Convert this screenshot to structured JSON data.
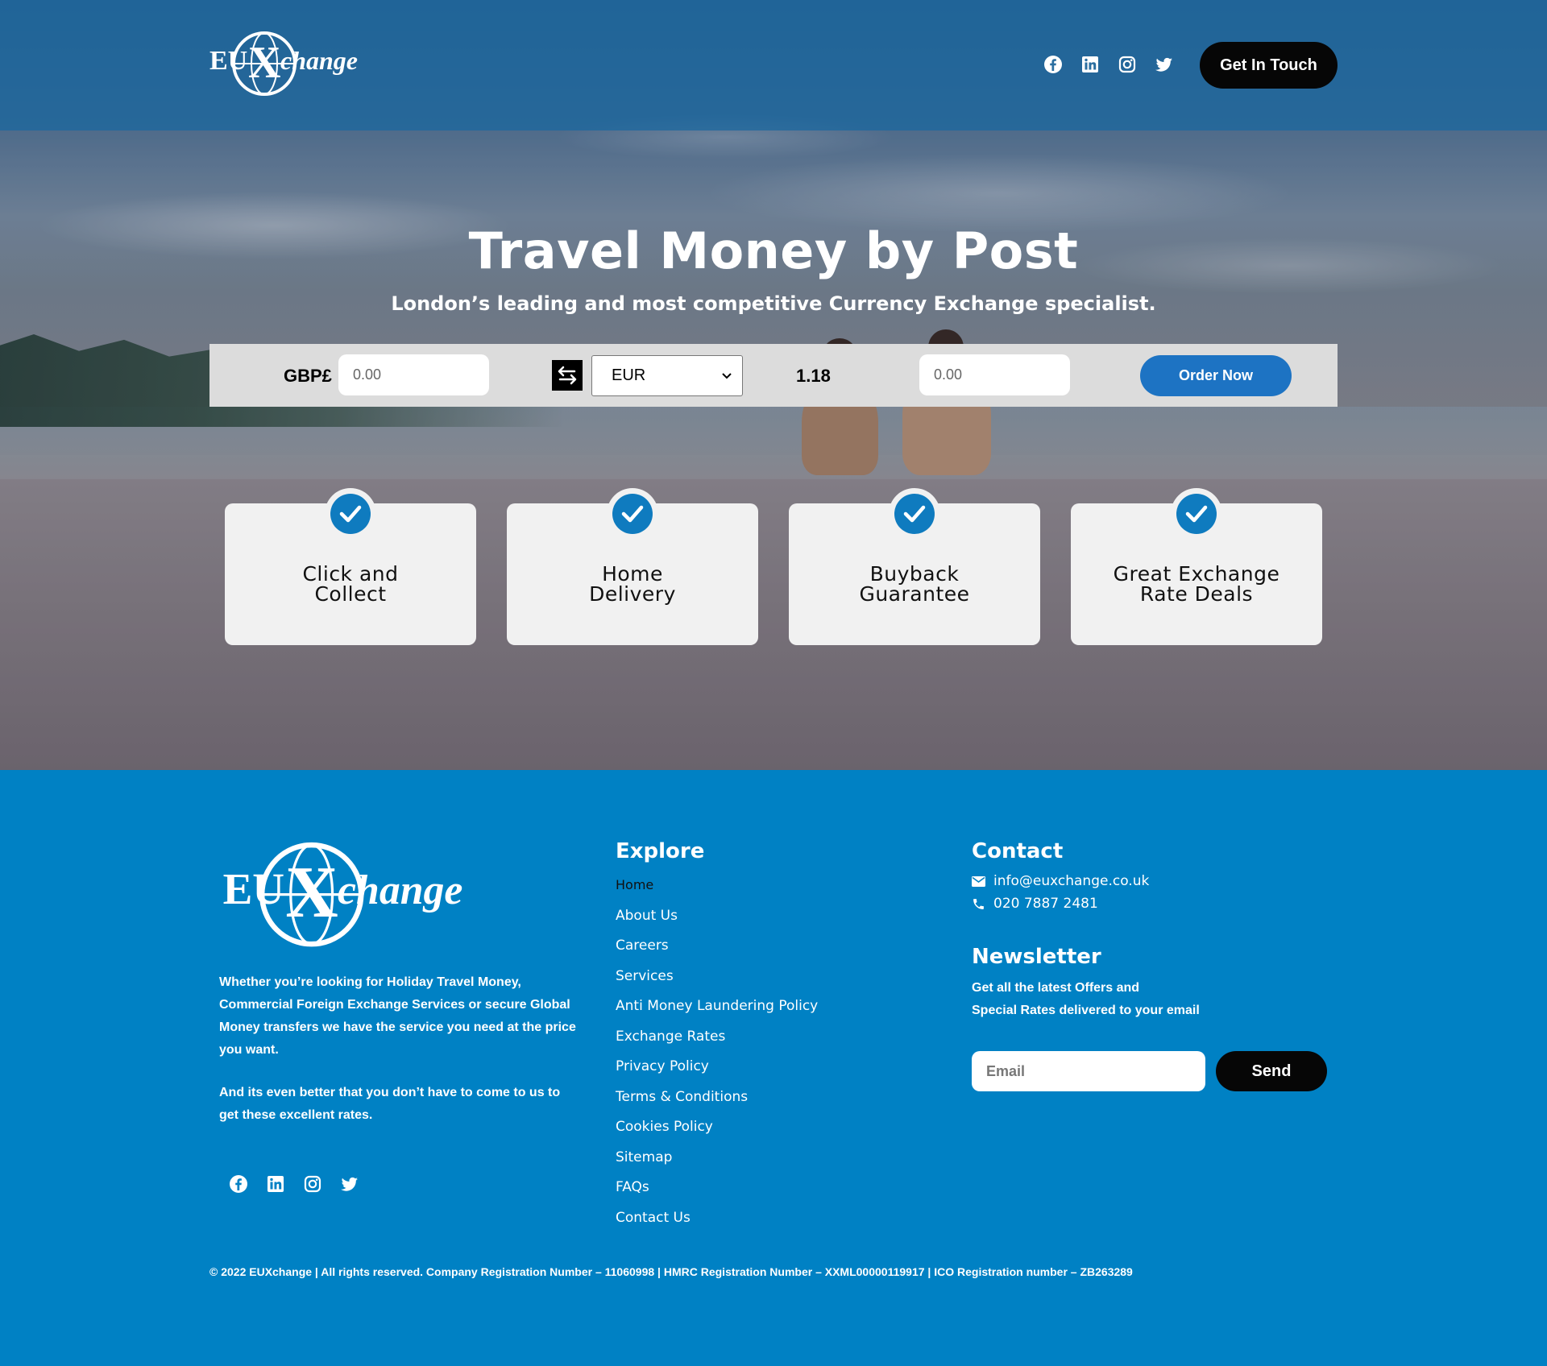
{
  "brand": {
    "logo_text_left": "EU",
    "logo_text_mark": "X",
    "logo_text_right": "change"
  },
  "header": {
    "social_icons": [
      "facebook-icon",
      "linkedin-icon",
      "instagram-icon",
      "twitter-icon"
    ],
    "cta_label": "Get In Touch"
  },
  "hero": {
    "title": "Travel Money by Post",
    "subtitle": "London’s leading and most competitive Currency Exchange specialist."
  },
  "converter": {
    "from_currency_label": "GBP£",
    "from_amount_placeholder": "0.00",
    "swap_icon": "swap-arrows-icon",
    "to_currency_selected": "EUR",
    "rate": "1.18",
    "to_amount_placeholder": "0.00",
    "order_label": "Order Now"
  },
  "features": [
    {
      "title": "Click and\nCollect"
    },
    {
      "title": "Home\nDelivery"
    },
    {
      "title": "Buyback\nGuarantee"
    },
    {
      "title": "Great Exchange\nRate Deals"
    }
  ],
  "footer": {
    "about_paragraph_1": "Whether you’re looking for Holiday Travel Money, Commercial Foreign Exchange Services or secure Global Money transfers we have the service you need at the price you want.",
    "about_paragraph_2": "And its even better that you don’t have to come to us to get these excellent rates.",
    "explore": {
      "title": "Explore",
      "links": [
        "Home",
        "About Us",
        "Careers",
        "Services",
        "Anti Money Laundering Policy",
        "Exchange Rates",
        "Privacy Policy",
        "Terms & Conditions",
        "Cookies Policy",
        "Sitemap",
        "FAQs",
        "Contact Us"
      ]
    },
    "contact": {
      "title": "Contact",
      "email": "info@euxchange.co.uk",
      "phone": "020 7887 2481"
    },
    "newsletter": {
      "title": "Newsletter",
      "description_line_1": "Get all the latest Offers and",
      "description_line_2": "Special Rates delivered to your email",
      "email_placeholder": "Email",
      "send_label": "Send"
    },
    "copyright": "© 2022 EUXchange | All rights reserved. Company Registration Number – 11060998 | HMRC Registration Number – XXML00000119917 | ICO Registration number – ZB263289"
  },
  "colors": {
    "primary_blue": "#0081c4",
    "button_blue": "#1d73c3",
    "check_blue": "#0f7bbf",
    "black_button": "#060606"
  }
}
